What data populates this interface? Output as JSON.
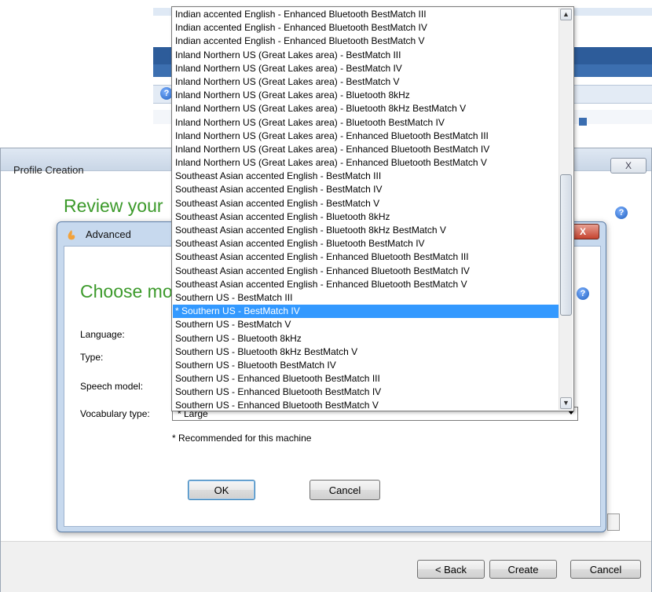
{
  "profile_window": {
    "title": "Profile Creation",
    "close_label": "X",
    "heading": "Review your",
    "help_label": "?",
    "buttons": {
      "back": "< Back",
      "create": "Create",
      "cancel": "Cancel"
    }
  },
  "advanced_dialog": {
    "title": "Advanced",
    "close_label": "X",
    "heading": "Choose mo",
    "help_label": "?",
    "labels": {
      "language": "Language:",
      "type": "Type:",
      "speech_model": "Speech model:",
      "vocabulary_type": "Vocabulary type:"
    },
    "vocabulary_value": "* Large",
    "note": "* Recommended for this machine",
    "buttons": {
      "ok": "OK",
      "cancel": "Cancel"
    }
  },
  "speech_model_dropdown": {
    "selected_index": 22,
    "items": [
      "Indian accented English - Enhanced Bluetooth BestMatch III",
      "Indian accented English - Enhanced Bluetooth BestMatch IV",
      "Indian accented English - Enhanced Bluetooth BestMatch V",
      "Inland Northern US (Great Lakes area) - BestMatch III",
      "Inland Northern US (Great Lakes area) - BestMatch IV",
      "Inland Northern US (Great Lakes area) - BestMatch V",
      "Inland Northern US (Great Lakes area) - Bluetooth 8kHz",
      "Inland Northern US (Great Lakes area) - Bluetooth 8kHz BestMatch V",
      "Inland Northern US (Great Lakes area) - Bluetooth BestMatch IV",
      "Inland Northern US (Great Lakes area) - Enhanced Bluetooth BestMatch III",
      "Inland Northern US (Great Lakes area) - Enhanced Bluetooth BestMatch IV",
      "Inland Northern US (Great Lakes area) - Enhanced Bluetooth BestMatch V",
      "Southeast Asian accented English - BestMatch III",
      "Southeast Asian accented English - BestMatch IV",
      "Southeast Asian accented English - BestMatch V",
      "Southeast Asian accented English - Bluetooth 8kHz",
      "Southeast Asian accented English - Bluetooth 8kHz BestMatch V",
      "Southeast Asian accented English - Bluetooth BestMatch IV",
      "Southeast Asian accented English - Enhanced Bluetooth BestMatch III",
      "Southeast Asian accented English - Enhanced Bluetooth BestMatch IV",
      "Southeast Asian accented English - Enhanced Bluetooth BestMatch V",
      "Southern US - BestMatch III",
      "* Southern US - BestMatch IV",
      "Southern US - BestMatch V",
      "Southern US - Bluetooth 8kHz",
      "Southern US - Bluetooth 8kHz BestMatch V",
      "Southern US - Bluetooth BestMatch IV",
      "Southern US - Enhanced Bluetooth BestMatch III",
      "Southern US - Enhanced Bluetooth BestMatch IV",
      "Southern US - Enhanced Bluetooth BestMatch V"
    ]
  },
  "colors": {
    "heading_green": "#3c9a2b",
    "selection_blue": "#3399ff"
  }
}
